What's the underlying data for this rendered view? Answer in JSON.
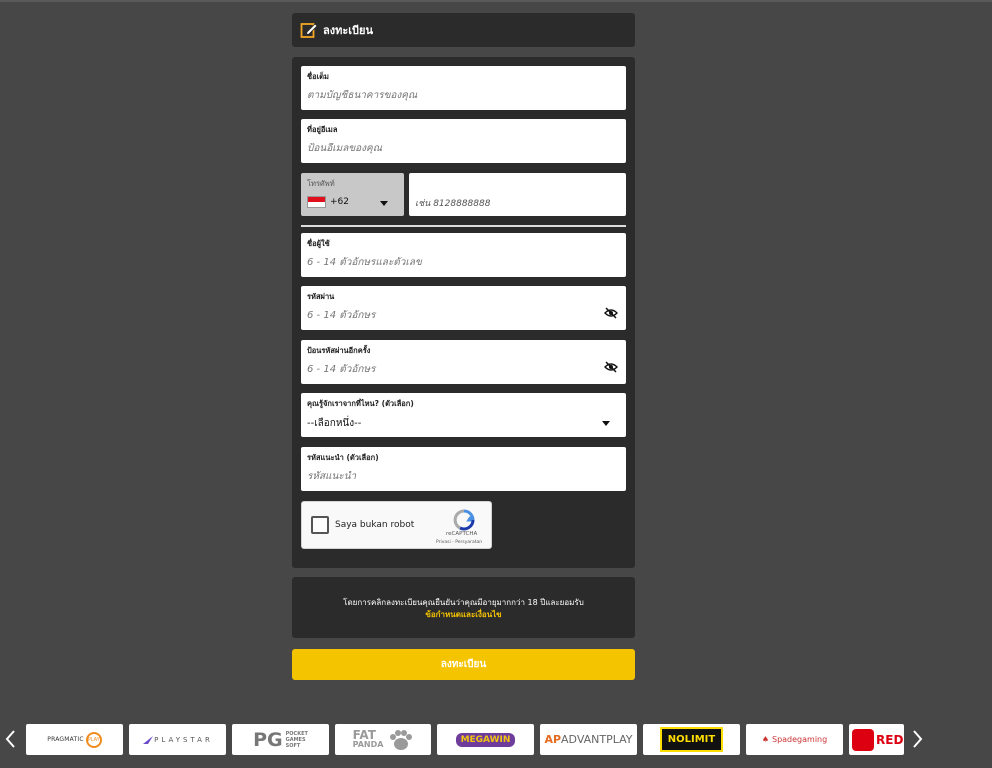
{
  "header": {
    "title": "ลงทะเบียน",
    "icon": "edit-icon"
  },
  "form": {
    "fullname": {
      "label": "ชื่อเต็ม",
      "placeholder": "ตามบัญชีธนาคารของคุณ"
    },
    "email": {
      "label": "ที่อยู่อีเมล",
      "placeholder": "ป้อนอีเมลของคุณ"
    },
    "phone": {
      "label": "โทรศัพท์",
      "country_code": "+62",
      "placeholder": "เช่น 8128888888"
    },
    "username": {
      "label": "ชื่อผู้ใช้",
      "placeholder": "6 - 14 ตัวอักษรและตัวเลข"
    },
    "password": {
      "label": "รหัสผ่าน",
      "placeholder": "6 - 14 ตัวอักษร"
    },
    "confirm_password": {
      "label": "ป้อนรหัสผ่านอีกครั้ง",
      "placeholder": "6 - 14 ตัวอักษร"
    },
    "referral_source": {
      "label": "คุณรู้จักเราจากที่ไหน? (ตัวเลือก)",
      "selected": "--เลือกหนึ่ง--"
    },
    "referral_code": {
      "label": "รหัสแนะนำ (ตัวเลือก)",
      "placeholder": "รหัสแนะนำ"
    }
  },
  "recaptcha": {
    "label": "Saya bukan robot",
    "brand": "reCAPTCHA",
    "links": "Privasi - Persyaratan"
  },
  "terms": {
    "text": "โดยการคลิกลงทะเบียนคุณยืนยันว่าคุณมีอายุมากกว่า 18 ปีและยอมรับ",
    "link": "ข้อกำหนดและเงื่อนไข"
  },
  "submit_label": "ลงทะเบียน",
  "providers": {
    "pragmatic": "PRAGMATIC",
    "pragmatic_badge": "PLAY",
    "playstar": "PLAYSTAR",
    "pg": "PG",
    "pg_sub1": "POCKET",
    "pg_sub2": "GAMES",
    "pg_sub3": "SOFT",
    "fatpanda1": "FAT",
    "fatpanda2": "PANDA",
    "megawin": "MEGAWIN",
    "advantplay_a": "AP",
    "advantplay_rest": "ADVANTPLAY",
    "nolimit": "NOLIMIT",
    "spadegaming": "Spadegaming",
    "red": "RED"
  },
  "colors": {
    "accent": "#f5c400",
    "panel": "#2b2b2b",
    "background": "#474747",
    "link": "#f3c300"
  }
}
